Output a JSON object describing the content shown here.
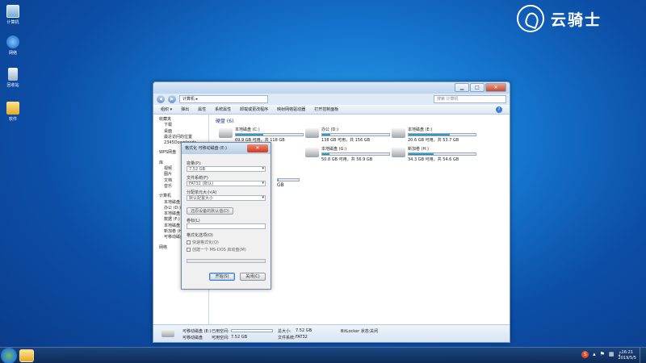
{
  "desktop": {
    "icons": [
      {
        "label": "计算机"
      },
      {
        "label": "网络"
      },
      {
        "label": "回收站"
      },
      {
        "label": "软件"
      }
    ]
  },
  "logo": {
    "text": "云骑士"
  },
  "explorer": {
    "address": "计算机 ▸",
    "search_placeholder": "搜索 计算机",
    "toolbar": [
      "组织 ▾",
      "弹出",
      "属性",
      "系统属性",
      "卸载或更改程序",
      "映射网络驱动器",
      "打开控制面板"
    ],
    "nav": {
      "favorites": "收藏夹",
      "fav_items": [
        "下载",
        "桌面",
        "最近访问的位置",
        "2345Downloads"
      ],
      "wps": "WPS网盘",
      "libraries": "库",
      "lib_items": [
        "视频",
        "图片",
        "文档",
        "音乐"
      ],
      "computer": "计算机",
      "comp_items": [
        "本地磁盘 (C:)",
        "办公 (D:)",
        "本地磁盘",
        "数据 (F:)",
        "本地磁盘",
        "新加卷 (H:)",
        "可移动磁盘"
      ],
      "network": "网络"
    },
    "section_title": "硬盘 (6)",
    "drives": [
      {
        "name": "本地磁盘 (C:)",
        "space": "69.9 GB 可用，共 118 GB",
        "fill": 41
      },
      {
        "name": "办公 (D:)",
        "space": "138 GB 可用，共 156 GB",
        "fill": 12
      },
      {
        "name": "本地磁盘 (E:)",
        "space": "20.6 GB 可用，共 53.7 GB",
        "fill": 62
      },
      {
        "name": "",
        "space": "",
        "fill": 3
      },
      {
        "name": "本地磁盘 (G:)",
        "space": "50.8 GB 可用，共 56.9 GB",
        "fill": 11
      },
      {
        "name": "新加卷 (H:)",
        "space": "34.3 GB 可用，共 54.6 GB",
        "fill": 37
      }
    ],
    "partial_drive": {
      "space": "GB"
    },
    "status": {
      "name": "可移动磁盘 (E:)",
      "used_label": "已用空间:",
      "free_label": "可用空间:",
      "free": "7.52 GB",
      "total_label": "总大小:",
      "total": "7.52 GB",
      "bitlocker_label": "BitLocker 状态:",
      "bitlocker": "关闭",
      "type": "可移动磁盘",
      "fs_label": "文件系统:",
      "fs": "FAT32"
    }
  },
  "format_dialog": {
    "title": "格式化 可移动磁盘 (E:)",
    "close": "✕",
    "capacity_label": "容量(P):",
    "capacity": "7.52 GB",
    "fs_label": "文件系统(F)",
    "fs": "FAT32 (默认)",
    "alloc_label": "分配单元大小(A)",
    "alloc": "默认配置大小",
    "restore_defaults": "还原设备的默认值(D)",
    "volume_label": "卷标(L)",
    "options_label": "格式化选项(O)",
    "quick_format": "快速格式化(Q)",
    "msdos": "创建一个 MS-DOS 启动盘(M)",
    "start": "开始(S)",
    "close_btn": "关闭(C)"
  },
  "taskbar": {
    "tray_s": "S",
    "clock_time": "16:21",
    "clock_date": "2019/5/5"
  }
}
